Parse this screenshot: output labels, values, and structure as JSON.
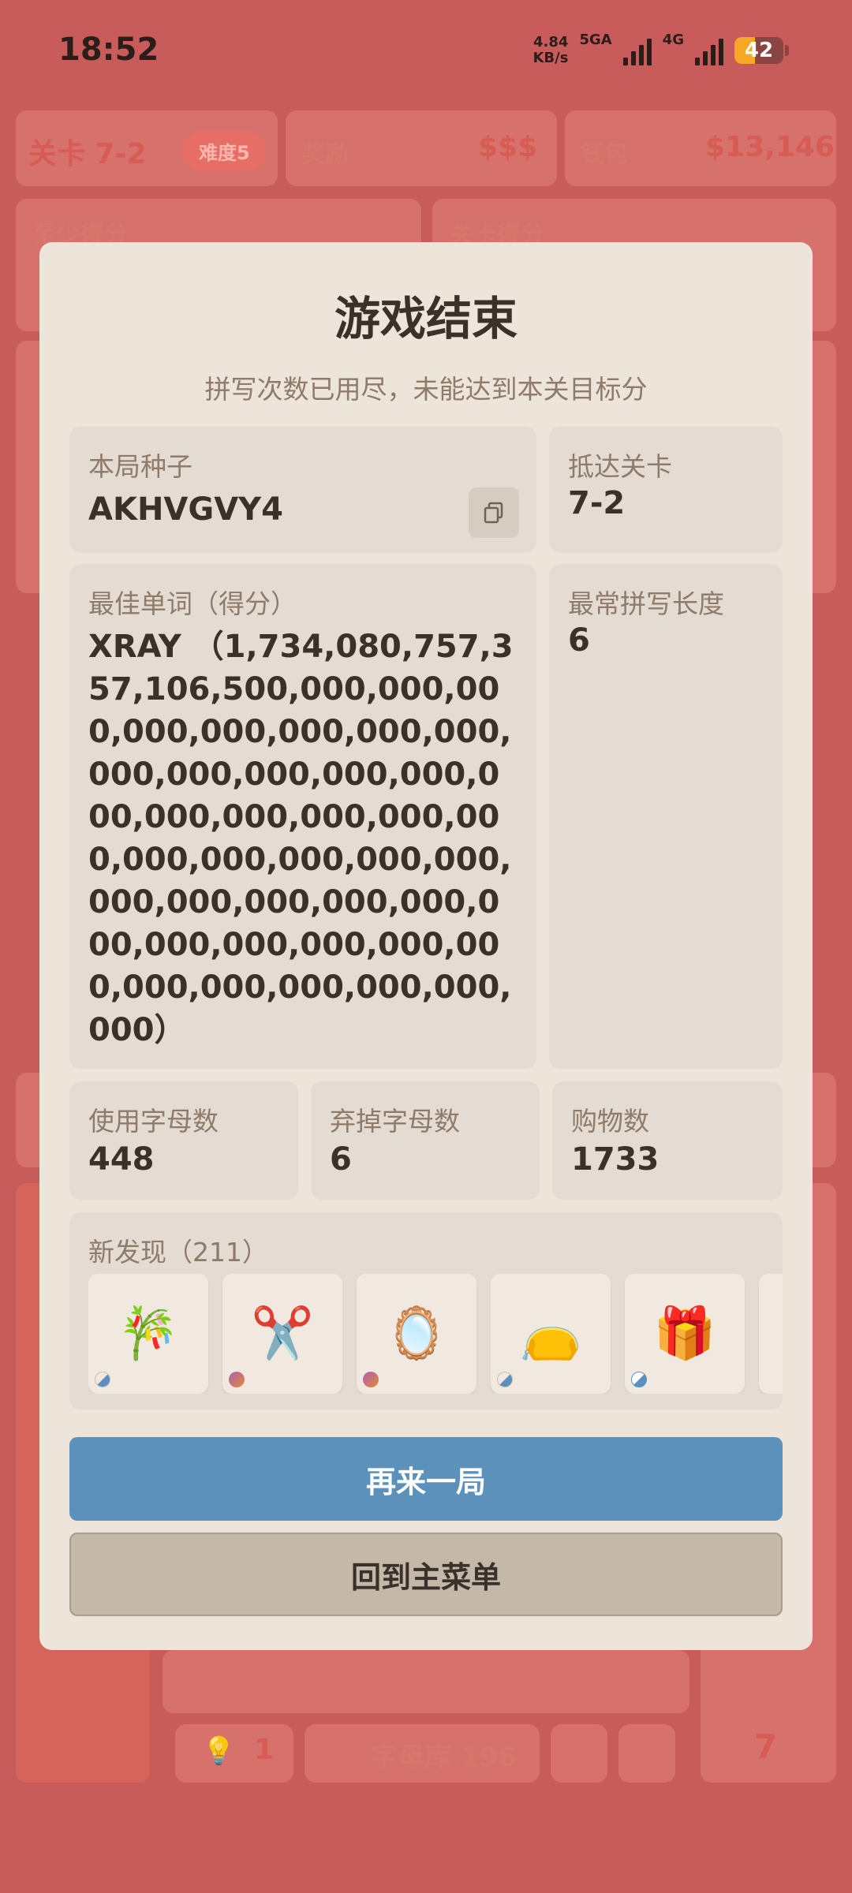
{
  "status_bar": {
    "time": "18:52",
    "speed_value": "4.84",
    "speed_unit": "KB/s",
    "network_1": "5GA",
    "network_2": "4G",
    "battery": "42"
  },
  "background": {
    "level_label": "关卡 7-2",
    "difficulty": "难度5",
    "reward_label": "奖励",
    "reward_value": "$$$",
    "wallet_label": "钱包",
    "wallet_value": "$13,146",
    "min_score_label": "至少得分",
    "level_score_label": "关卡得分",
    "hint_count": "1",
    "letter_bank": "字母库 196",
    "right_count": "7"
  },
  "modal": {
    "title": "游戏结束",
    "subtitle": "拼写次数已用尽，未能达到本关目标分",
    "seed": {
      "label": "本局种子",
      "value": "AKHVGVY4",
      "copy_icon": "copy-icon"
    },
    "reached_level": {
      "label": "抵达关卡",
      "value": "7-2"
    },
    "best_word": {
      "label": "最佳单词（得分）",
      "value": "XRAY （1,734,080,757,357,106,500,000,000,000,000,000,000,000,000,000,000,000,000,000,000,000,000,000,000,000,000,000,000,000,000,000,000,000,000,000,000,000,000,000,000,000,000,000,000,000,000,000）"
    },
    "common_length": {
      "label": "最常拼写长度",
      "value": "6"
    },
    "letters_used": {
      "label": "使用字母数",
      "value": "448"
    },
    "letters_discarded": {
      "label": "弃掉字母数",
      "value": "6"
    },
    "purchases": {
      "label": "购物数",
      "value": "1733"
    },
    "discoveries": {
      "label": "新发现（211）",
      "items": [
        {
          "emoji": "🎋",
          "name": "bamboo-icon"
        },
        {
          "emoji": "✂️",
          "name": "scissors-icon"
        },
        {
          "emoji": "🪞",
          "name": "mirror-icon"
        },
        {
          "emoji": "👝",
          "name": "pouch-icon"
        },
        {
          "emoji": "🎁",
          "name": "gift-icon"
        }
      ]
    },
    "play_again": "再来一局",
    "main_menu": "回到主菜单"
  },
  "colors": {
    "background": "#c85c5a",
    "modal": "#ede4da",
    "panel": "#e4dbd2",
    "primary_button": "#5b91bb",
    "secondary_button": "#c4b8a8"
  }
}
